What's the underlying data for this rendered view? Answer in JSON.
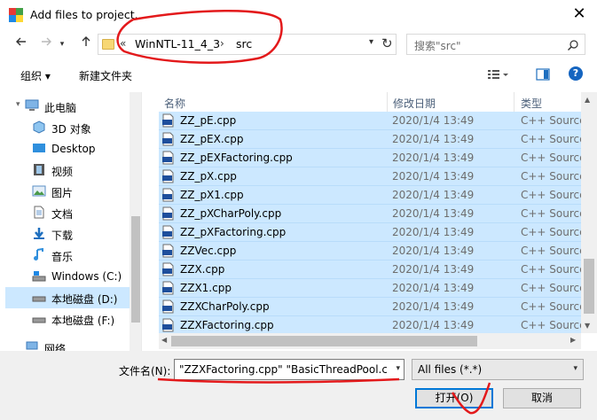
{
  "window": {
    "title": "Add files to project...",
    "close_glyph": "✕"
  },
  "nav": {
    "back_icon": "arrow-left-icon",
    "forward_icon": "arrow-right-icon",
    "recent_icon": "chevron-down-icon",
    "up_icon": "arrow-up-icon",
    "breadcrumb_sep": "«",
    "path": [
      "WinNTL-11_4_3",
      "src"
    ],
    "path_sep": "›",
    "search_placeholder": "搜索\"src\""
  },
  "toolbar": {
    "organize": "组织 ▾",
    "new_folder": "新建文件夹",
    "help": "?"
  },
  "sidebar": {
    "items": [
      {
        "label": "此电脑",
        "icon": "computer-icon"
      },
      {
        "label": "3D 对象",
        "icon": "cube-icon"
      },
      {
        "label": "Desktop",
        "icon": "desktop-icon"
      },
      {
        "label": "视频",
        "icon": "video-icon"
      },
      {
        "label": "图片",
        "icon": "picture-icon"
      },
      {
        "label": "文档",
        "icon": "document-icon"
      },
      {
        "label": "下载",
        "icon": "download-icon"
      },
      {
        "label": "音乐",
        "icon": "music-icon"
      },
      {
        "label": "Windows (C:)",
        "icon": "drive-icon"
      },
      {
        "label": "本地磁盘 (D:)",
        "icon": "drive-icon",
        "selected": true
      },
      {
        "label": "本地磁盘 (F:)",
        "icon": "drive-icon"
      },
      {
        "label": "网络",
        "icon": "network-icon"
      }
    ]
  },
  "columns": {
    "name": "名称",
    "date": "修改日期",
    "type": "类型"
  },
  "files": [
    {
      "name": "ZZ_pE.cpp",
      "date": "2020/1/4 13:49",
      "type": "C++ Source"
    },
    {
      "name": "ZZ_pEX.cpp",
      "date": "2020/1/4 13:49",
      "type": "C++ Source"
    },
    {
      "name": "ZZ_pEXFactoring.cpp",
      "date": "2020/1/4 13:49",
      "type": "C++ Source"
    },
    {
      "name": "ZZ_pX.cpp",
      "date": "2020/1/4 13:49",
      "type": "C++ Source"
    },
    {
      "name": "ZZ_pX1.cpp",
      "date": "2020/1/4 13:49",
      "type": "C++ Source"
    },
    {
      "name": "ZZ_pXCharPoly.cpp",
      "date": "2020/1/4 13:49",
      "type": "C++ Source"
    },
    {
      "name": "ZZ_pXFactoring.cpp",
      "date": "2020/1/4 13:49",
      "type": "C++ Source"
    },
    {
      "name": "ZZVec.cpp",
      "date": "2020/1/4 13:49",
      "type": "C++ Source"
    },
    {
      "name": "ZZX.cpp",
      "date": "2020/1/4 13:49",
      "type": "C++ Source"
    },
    {
      "name": "ZZX1.cpp",
      "date": "2020/1/4 13:49",
      "type": "C++ Source"
    },
    {
      "name": "ZZXCharPoly.cpp",
      "date": "2020/1/4 13:49",
      "type": "C++ Source"
    },
    {
      "name": "ZZXFactoring.cpp",
      "date": "2020/1/4 13:49",
      "type": "C++ Source"
    }
  ],
  "footer": {
    "filename_label": "文件名(N):",
    "filename_value": "\"ZZXFactoring.cpp\" \"BasicThreadPool.cp",
    "filetype_value": "All files (*.*)",
    "open_button": "打开(O)",
    "cancel_button": "取消"
  },
  "colors": {
    "selection": "#cce8ff",
    "accent": "#0078d7",
    "annotation": "#e3191b"
  }
}
